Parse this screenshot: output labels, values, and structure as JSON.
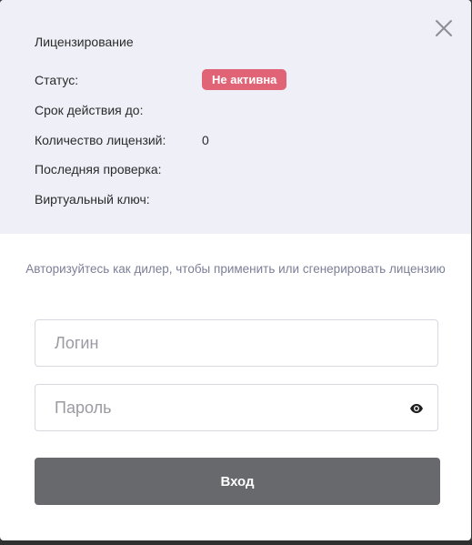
{
  "dialog": {
    "title": "Лицензирование",
    "close_icon": "close-icon",
    "rows": {
      "status_label": "Статус:",
      "status_value": "Не активна",
      "expiry_label": "Срок действия до:",
      "count_label": "Количество лицензий:",
      "count_value": "0",
      "last_check_label": "Последняя проверка:",
      "virtual_key_label": "Виртуальный ключ:"
    },
    "hint": "Авторизуйтесь как дилер, чтобы применить или сгенерировать лицензию",
    "login_field": {
      "placeholder": "Логин",
      "value": ""
    },
    "password_field": {
      "placeholder": "Пароль",
      "value": "",
      "toggle_icon": "eye-icon"
    },
    "submit_label": "Вход"
  },
  "colors": {
    "header_background": "#efeff8",
    "status_badge": "#e06376",
    "submit_button": "#68696d",
    "hint_text": "#7b7f97"
  }
}
